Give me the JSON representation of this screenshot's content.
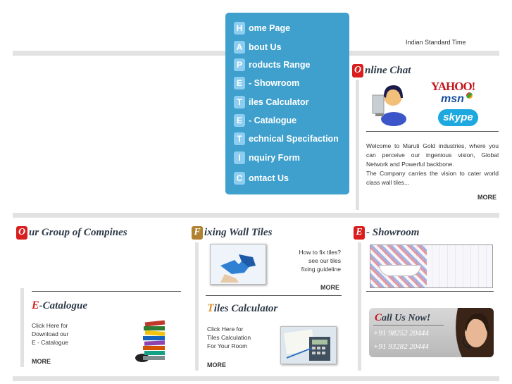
{
  "nav": {
    "items": [
      {
        "letter": "H",
        "text": "ome Page"
      },
      {
        "letter": "A",
        "text": "bout Us"
      },
      {
        "letter": "P",
        "text": "roducts Range"
      },
      {
        "letter": "E",
        "text": "- Showroom"
      },
      {
        "letter": "T",
        "text": "iles Calculator"
      },
      {
        "letter": "E",
        "text": "- Catalogue"
      },
      {
        "letter": "T",
        "text": "echnical Specifaction"
      },
      {
        "letter": "I",
        "text": "nquiry Form"
      },
      {
        "letter": "C",
        "text": "ontact Us"
      }
    ]
  },
  "time": {
    "label": "Indian Standard Time"
  },
  "chat": {
    "cap": "O",
    "title": "nline Chat",
    "yahoo": "YAHOO!",
    "msn": "msn",
    "skype": "skype",
    "text": "Welcome to Maruti Gold industries, where you can perceive our ingenious vision, Global Network and Powerful backbone.\nThe Company carries the vision to cater world class wall tiles...",
    "more": "MORE"
  },
  "group": {
    "cap": "O",
    "title": "ur Group of Compines"
  },
  "ecatalogue": {
    "cap": "E",
    "title": "-Catalogue",
    "text": "Click Here for\nDownload our\nE - Catalogue",
    "more": "MORE"
  },
  "fixing": {
    "cap": "F",
    "title": "ixing Wall Tiles",
    "text": "How to fix tiles?\nsee our tiles\nfixing guideline",
    "more": "MORE"
  },
  "calculator": {
    "cap": "T",
    "title": "iles Calculator",
    "text": "Click Here for\nTiles Calculation\nFor Your Room",
    "more": "MORE"
  },
  "showroom": {
    "cap": "E",
    "title": "- Showroom"
  },
  "callus": {
    "cap": "C",
    "title": "all Us Now!",
    "phone1": "+91 98252 20444",
    "phone2": "+91 93282 20444"
  },
  "colors": {
    "nav_bg": "#3fa0cd",
    "accent_red": "#d81e1e",
    "accent_brown": "#b0812f"
  }
}
